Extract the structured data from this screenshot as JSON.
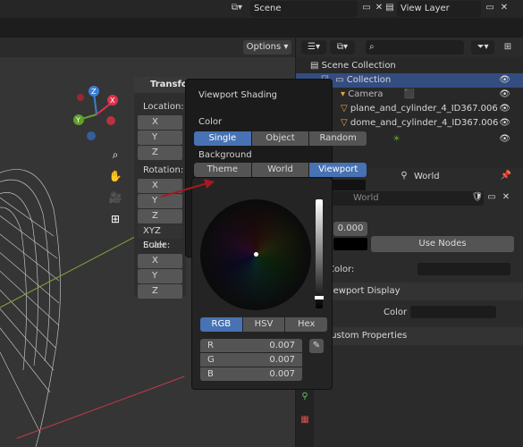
{
  "topbar": {
    "scene": "Scene",
    "view_layer": "View Layer"
  },
  "header": {
    "options_label": "Options"
  },
  "npanel": {
    "transform_title": "Transform",
    "location_label": "Location:",
    "rotation_label": "Rotation:",
    "scale_label": "Scale:",
    "euler_mode": "XYZ Euler",
    "axis_x": "X",
    "axis_y": "Y",
    "axis_z": "Z"
  },
  "shading_popup": {
    "title": "Viewport Shading",
    "color_label": "Color",
    "color_options": [
      "Single",
      "Object",
      "Random"
    ],
    "background_label": "Background",
    "background_options": [
      "Theme",
      "World",
      "Viewport"
    ]
  },
  "picker": {
    "modes": [
      "RGB",
      "HSV",
      "Hex"
    ],
    "r_label": "R",
    "r_value": "0.007",
    "g_label": "G",
    "g_value": "0.007",
    "b_label": "B",
    "b_value": "0.007"
  },
  "outliner": {
    "search_placeholder": "",
    "scene_collection": "Scene Collection",
    "collection": "Collection",
    "camera": "Camera",
    "obj1": "plane_and_cylinder_4_ID367.006",
    "obj2": "dome_and_cylinder_4_ID367.006"
  },
  "props": {
    "world_tab": "World",
    "world_name": "World",
    "strength_value": "0.000",
    "use_nodes": "Use Nodes",
    "color_label": "Color:",
    "viewport_display": "Viewport Display",
    "vp_color_label": "Color",
    "custom_properties": "Custom Properties"
  },
  "colors": {
    "accent": "#4772b3",
    "gizmo_x": "#e0314d",
    "gizmo_y": "#62a02d",
    "gizmo_z": "#3a7fd6"
  }
}
